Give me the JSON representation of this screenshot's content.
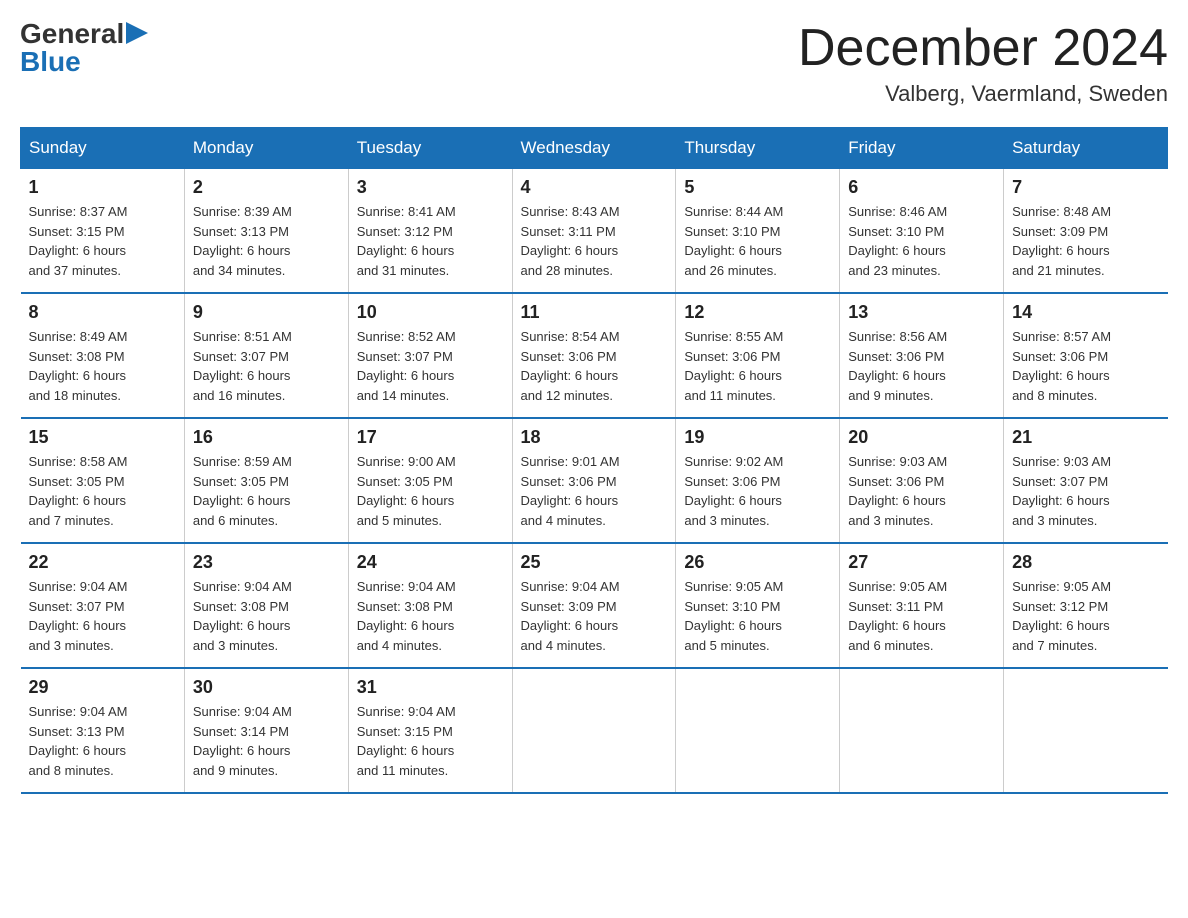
{
  "logo": {
    "general": "General",
    "blue": "Blue"
  },
  "title": "December 2024",
  "location": "Valberg, Vaermland, Sweden",
  "days_of_week": [
    "Sunday",
    "Monday",
    "Tuesday",
    "Wednesday",
    "Thursday",
    "Friday",
    "Saturday"
  ],
  "weeks": [
    [
      {
        "day": "1",
        "info": "Sunrise: 8:37 AM\nSunset: 3:15 PM\nDaylight: 6 hours\nand 37 minutes."
      },
      {
        "day": "2",
        "info": "Sunrise: 8:39 AM\nSunset: 3:13 PM\nDaylight: 6 hours\nand 34 minutes."
      },
      {
        "day": "3",
        "info": "Sunrise: 8:41 AM\nSunset: 3:12 PM\nDaylight: 6 hours\nand 31 minutes."
      },
      {
        "day": "4",
        "info": "Sunrise: 8:43 AM\nSunset: 3:11 PM\nDaylight: 6 hours\nand 28 minutes."
      },
      {
        "day": "5",
        "info": "Sunrise: 8:44 AM\nSunset: 3:10 PM\nDaylight: 6 hours\nand 26 minutes."
      },
      {
        "day": "6",
        "info": "Sunrise: 8:46 AM\nSunset: 3:10 PM\nDaylight: 6 hours\nand 23 minutes."
      },
      {
        "day": "7",
        "info": "Sunrise: 8:48 AM\nSunset: 3:09 PM\nDaylight: 6 hours\nand 21 minutes."
      }
    ],
    [
      {
        "day": "8",
        "info": "Sunrise: 8:49 AM\nSunset: 3:08 PM\nDaylight: 6 hours\nand 18 minutes."
      },
      {
        "day": "9",
        "info": "Sunrise: 8:51 AM\nSunset: 3:07 PM\nDaylight: 6 hours\nand 16 minutes."
      },
      {
        "day": "10",
        "info": "Sunrise: 8:52 AM\nSunset: 3:07 PM\nDaylight: 6 hours\nand 14 minutes."
      },
      {
        "day": "11",
        "info": "Sunrise: 8:54 AM\nSunset: 3:06 PM\nDaylight: 6 hours\nand 12 minutes."
      },
      {
        "day": "12",
        "info": "Sunrise: 8:55 AM\nSunset: 3:06 PM\nDaylight: 6 hours\nand 11 minutes."
      },
      {
        "day": "13",
        "info": "Sunrise: 8:56 AM\nSunset: 3:06 PM\nDaylight: 6 hours\nand 9 minutes."
      },
      {
        "day": "14",
        "info": "Sunrise: 8:57 AM\nSunset: 3:06 PM\nDaylight: 6 hours\nand 8 minutes."
      }
    ],
    [
      {
        "day": "15",
        "info": "Sunrise: 8:58 AM\nSunset: 3:05 PM\nDaylight: 6 hours\nand 7 minutes."
      },
      {
        "day": "16",
        "info": "Sunrise: 8:59 AM\nSunset: 3:05 PM\nDaylight: 6 hours\nand 6 minutes."
      },
      {
        "day": "17",
        "info": "Sunrise: 9:00 AM\nSunset: 3:05 PM\nDaylight: 6 hours\nand 5 minutes."
      },
      {
        "day": "18",
        "info": "Sunrise: 9:01 AM\nSunset: 3:06 PM\nDaylight: 6 hours\nand 4 minutes."
      },
      {
        "day": "19",
        "info": "Sunrise: 9:02 AM\nSunset: 3:06 PM\nDaylight: 6 hours\nand 3 minutes."
      },
      {
        "day": "20",
        "info": "Sunrise: 9:03 AM\nSunset: 3:06 PM\nDaylight: 6 hours\nand 3 minutes."
      },
      {
        "day": "21",
        "info": "Sunrise: 9:03 AM\nSunset: 3:07 PM\nDaylight: 6 hours\nand 3 minutes."
      }
    ],
    [
      {
        "day": "22",
        "info": "Sunrise: 9:04 AM\nSunset: 3:07 PM\nDaylight: 6 hours\nand 3 minutes."
      },
      {
        "day": "23",
        "info": "Sunrise: 9:04 AM\nSunset: 3:08 PM\nDaylight: 6 hours\nand 3 minutes."
      },
      {
        "day": "24",
        "info": "Sunrise: 9:04 AM\nSunset: 3:08 PM\nDaylight: 6 hours\nand 4 minutes."
      },
      {
        "day": "25",
        "info": "Sunrise: 9:04 AM\nSunset: 3:09 PM\nDaylight: 6 hours\nand 4 minutes."
      },
      {
        "day": "26",
        "info": "Sunrise: 9:05 AM\nSunset: 3:10 PM\nDaylight: 6 hours\nand 5 minutes."
      },
      {
        "day": "27",
        "info": "Sunrise: 9:05 AM\nSunset: 3:11 PM\nDaylight: 6 hours\nand 6 minutes."
      },
      {
        "day": "28",
        "info": "Sunrise: 9:05 AM\nSunset: 3:12 PM\nDaylight: 6 hours\nand 7 minutes."
      }
    ],
    [
      {
        "day": "29",
        "info": "Sunrise: 9:04 AM\nSunset: 3:13 PM\nDaylight: 6 hours\nand 8 minutes."
      },
      {
        "day": "30",
        "info": "Sunrise: 9:04 AM\nSunset: 3:14 PM\nDaylight: 6 hours\nand 9 minutes."
      },
      {
        "day": "31",
        "info": "Sunrise: 9:04 AM\nSunset: 3:15 PM\nDaylight: 6 hours\nand 11 minutes."
      },
      {
        "day": "",
        "info": ""
      },
      {
        "day": "",
        "info": ""
      },
      {
        "day": "",
        "info": ""
      },
      {
        "day": "",
        "info": ""
      }
    ]
  ]
}
